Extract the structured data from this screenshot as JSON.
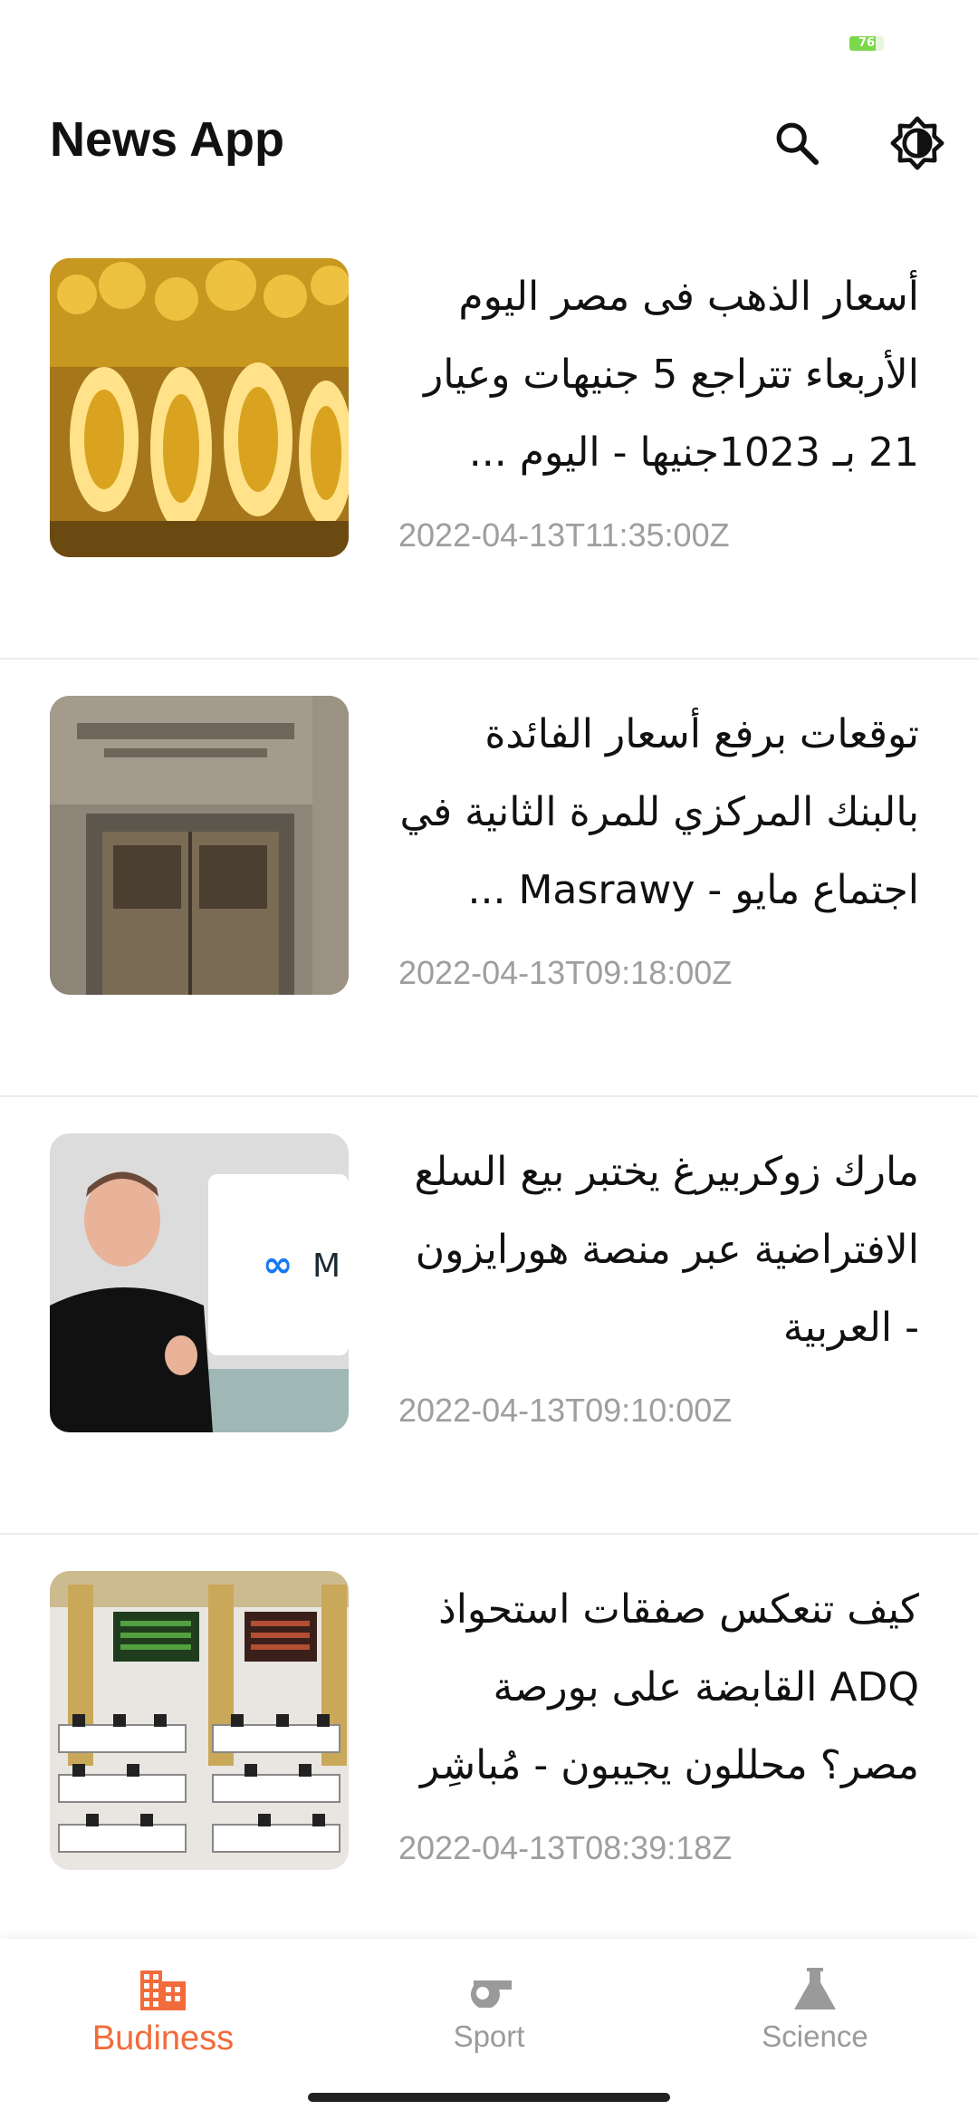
{
  "status_bar": {
    "battery_level": "76",
    "battery_fraction": 0.76,
    "battery_color": "#7bd84a"
  },
  "app_bar": {
    "title": "News App",
    "actions": [
      "search-icon",
      "brightness-icon"
    ]
  },
  "articles": [
    {
      "title": "أسعار الذهب فى مصر اليوم الأربعاء تتراجع 5 جنيهات وعيار 21 بـ 1023جنيها - اليوم ...",
      "published_at": "2022-04-13T11:35:00Z",
      "image": "gold-jewelry-photo"
    },
    {
      "title": "توقعات برفع أسعار الفائدة بالبنك المركزي للمرة الثانية في اجتماع مايو - Masrawy ...",
      "published_at": "2022-04-13T09:18:00Z",
      "image": "central-bank-of-egypt-photo"
    },
    {
      "title": "مارك زوكربيرغ يختبر بيع السلع الافتراضية عبر منصة هورايزون - العربية",
      "published_at": "2022-04-13T09:10:00Z",
      "image": "mark-zuckerberg-meta-photo"
    },
    {
      "title": "كيف تنعكس صفقات استحواذ ADQ  القابضة على بورصة مصر؟ محللون يجيبون - مُباشِر",
      "published_at": "2022-04-13T08:39:18Z",
      "image": "stock-exchange-trading-floor-photo"
    }
  ],
  "bottom_nav": {
    "items": [
      {
        "label": "Budiness",
        "icon": "business-building-icon",
        "active": true
      },
      {
        "label": "Sport",
        "icon": "whistle-icon",
        "active": false
      },
      {
        "label": "Science",
        "icon": "flask-icon",
        "active": false
      }
    ],
    "active_color": "#f26b3a",
    "inactive_color": "#9a9a9a"
  }
}
